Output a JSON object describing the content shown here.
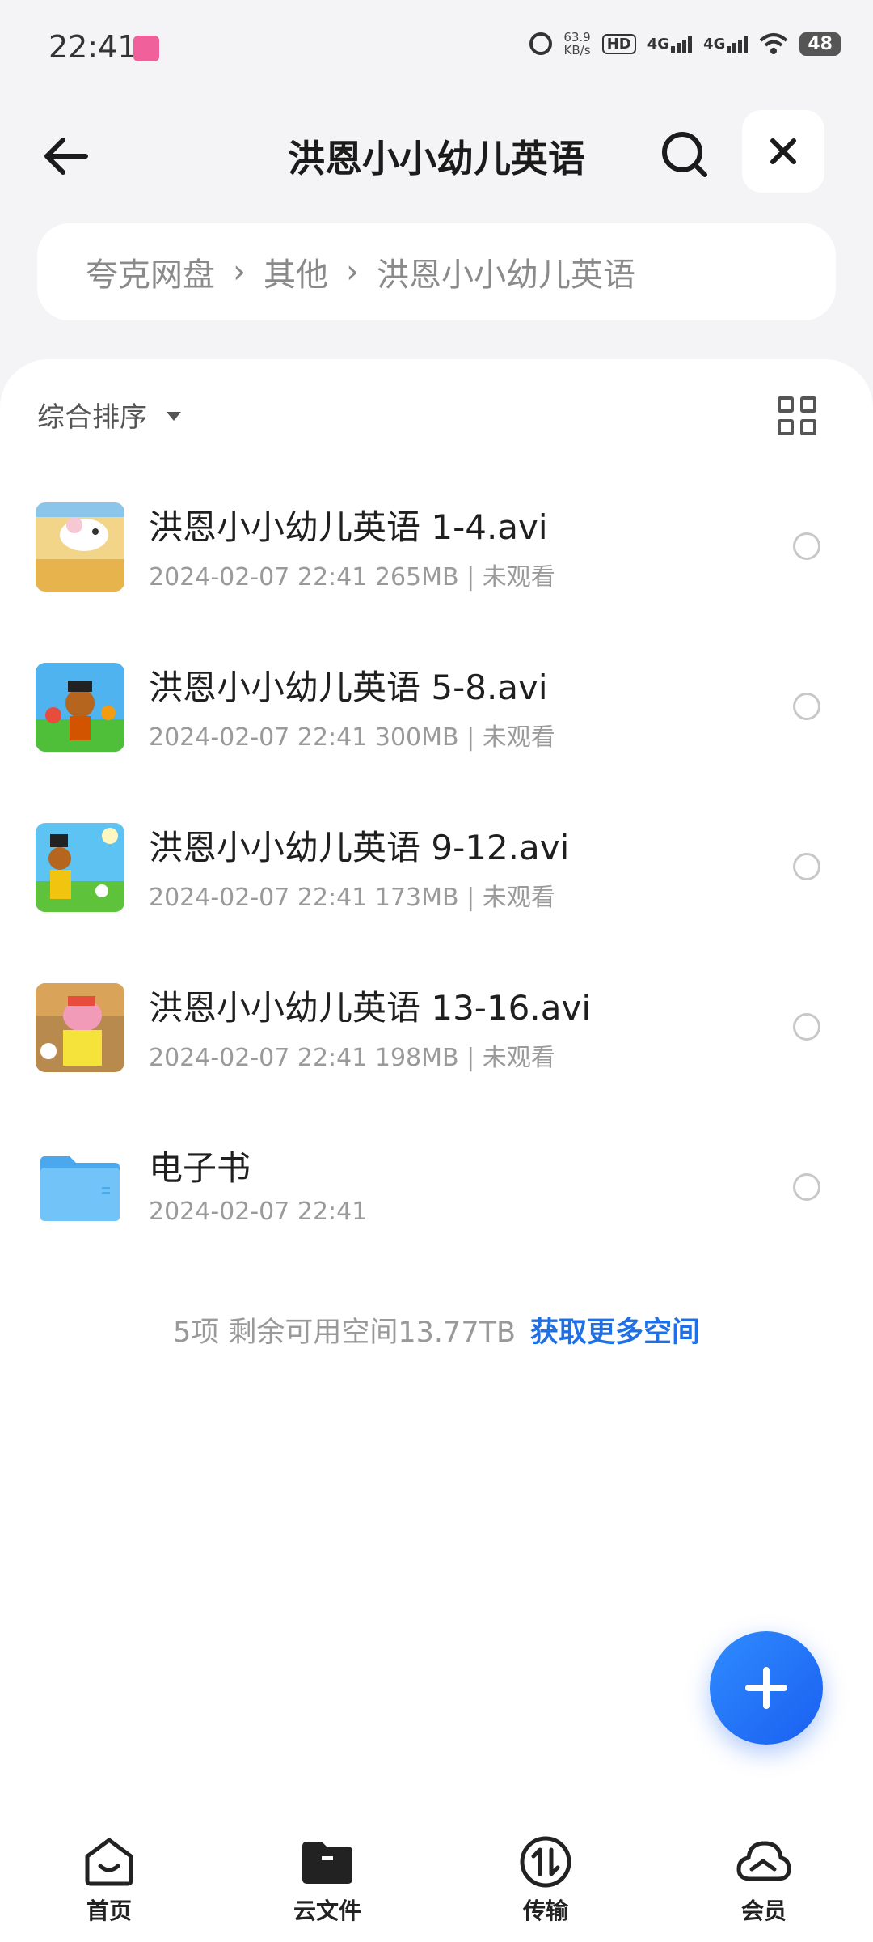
{
  "status_bar": {
    "time": "22:41",
    "net_speed_value": "63.9",
    "net_speed_unit": "KB/s",
    "hd_label": "HD",
    "signal1_label": "4G",
    "signal2_label": "4G",
    "battery": "48"
  },
  "header": {
    "title": "洪恩小小幼儿英语"
  },
  "breadcrumb": {
    "items": [
      "夸克网盘",
      "其他",
      "洪恩小小幼儿英语"
    ]
  },
  "toolbar": {
    "sort_label": "综合排序"
  },
  "files": [
    {
      "name": "洪恩小小幼儿英语 1-4.avi",
      "meta": "2024-02-07 22:41  265MB | 未观看",
      "thumb_icon": "video-thumbnail-mouse"
    },
    {
      "name": "洪恩小小幼儿英语 5-8.avi",
      "meta": "2024-02-07 22:41  300MB | 未观看",
      "thumb_icon": "video-thumbnail-cartoon"
    },
    {
      "name": "洪恩小小幼儿英语 9-12.avi",
      "meta": "2024-02-07 22:41  173MB | 未观看",
      "thumb_icon": "video-thumbnail-cartoon"
    },
    {
      "name": "洪恩小小幼儿英语 13-16.avi",
      "meta": "2024-02-07 22:41  198MB | 未观看",
      "thumb_icon": "video-thumbnail-hippo"
    },
    {
      "name": "电子书",
      "meta": "2024-02-07 22:41",
      "thumb_icon": "folder-icon"
    }
  ],
  "summary": {
    "text": "5项 剩余可用空间13.77TB",
    "link": "获取更多空间"
  },
  "bottom_nav": {
    "items": [
      {
        "label": "首页",
        "icon": "home-icon"
      },
      {
        "label": "云文件",
        "icon": "cloud-folder-icon"
      },
      {
        "label": "传输",
        "icon": "transfer-icon"
      },
      {
        "label": "会员",
        "icon": "cloud-member-icon"
      }
    ]
  },
  "colors": {
    "accent": "#1f6fe5",
    "fab": "#1a5ff0",
    "folder": "#5ab6f4"
  }
}
